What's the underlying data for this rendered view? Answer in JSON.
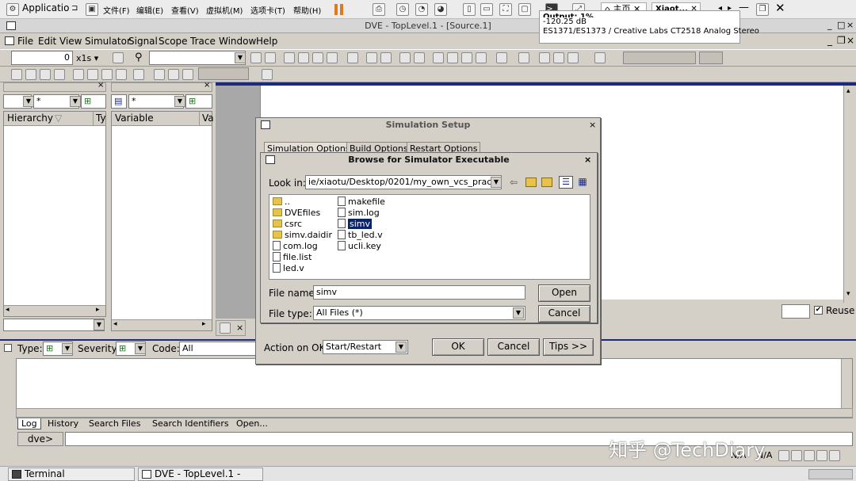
{
  "host_bar": {
    "applications": "Applicatio",
    "menu": [
      "文件(F)",
      "编辑(E)",
      "查看(V)",
      "虚拟机(M)",
      "选项卡(T)",
      "帮助(H)"
    ],
    "home_tab": "主页",
    "tab2": "Xiaot...",
    "audio_tooltip": {
      "title": "Output: 1%",
      "level": "-120.25 dB",
      "device": "ES1371/ES1373 / Creative Labs CT2518 Analog Stereo"
    }
  },
  "window": {
    "title": "DVE - TopLevel.1 - [Source.1]"
  },
  "menubar": [
    "File",
    "Edit",
    "View",
    "Simulator",
    "Signal",
    "Scope",
    "Trace",
    "Window",
    "Help"
  ],
  "toolbar": {
    "time_value": "0",
    "time_unit": "x1s"
  },
  "hierarchy_panel": {
    "filter": "*",
    "col_hierarchy": "Hierarchy",
    "col_type": "Ty"
  },
  "variable_panel": {
    "filter": "*",
    "col_variable": "Variable",
    "col_value": "Va"
  },
  "right_pane": {
    "reuse_label": "Reuse"
  },
  "console": {
    "type_label": "Type:",
    "severity_label": "Severity:",
    "code_label": "Code:",
    "code_value": "All",
    "tabs": [
      "Log",
      "History",
      "Search Files",
      "Search Identifiers",
      "Open..."
    ],
    "prompt": "dve>"
  },
  "sim_setup": {
    "title": "Simulation Setup",
    "tabs": [
      "Simulation Options",
      "Build Options",
      "Restart Options"
    ],
    "action_label": "Action on OK:",
    "action_value": "Start/Restart",
    "ok": "OK",
    "cancel": "Cancel",
    "tips": "Tips >>"
  },
  "browse": {
    "title": "Browse for Simulator Executable",
    "look_in_label": "Look in:",
    "look_in_value": "ie/xiaotu/Desktop/0201/my_own_vcs_practice/",
    "col1": [
      {
        "name": "..",
        "kind": "folder"
      },
      {
        "name": "DVEfiles",
        "kind": "folder"
      },
      {
        "name": "csrc",
        "kind": "folder"
      },
      {
        "name": "simv.daidir",
        "kind": "folder"
      },
      {
        "name": "com.log",
        "kind": "file"
      },
      {
        "name": "file.list",
        "kind": "file"
      },
      {
        "name": "led.v",
        "kind": "file"
      }
    ],
    "col2": [
      {
        "name": "makefile",
        "kind": "file"
      },
      {
        "name": "sim.log",
        "kind": "file"
      },
      {
        "name": "simv",
        "kind": "file",
        "selected": true
      },
      {
        "name": "tb_led.v",
        "kind": "file"
      },
      {
        "name": "ucli.key",
        "kind": "file"
      }
    ],
    "file_name_label": "File name:",
    "file_name_value": "simv",
    "file_type_label": "File type:",
    "file_type_value": "All Files (*)",
    "open": "Open",
    "cancel": "Cancel"
  },
  "status": {
    "na1": "N/A",
    "na2": "N/A"
  },
  "taskbar": {
    "items": [
      "Terminal",
      "DVE - TopLevel.1 - [So..."
    ]
  },
  "watermark": "知乎 @TechDiary",
  "colors": {
    "selection": "#0a246a",
    "desktop": "#d4d0c8",
    "dark_blue_rule": "#1b2a7a"
  }
}
